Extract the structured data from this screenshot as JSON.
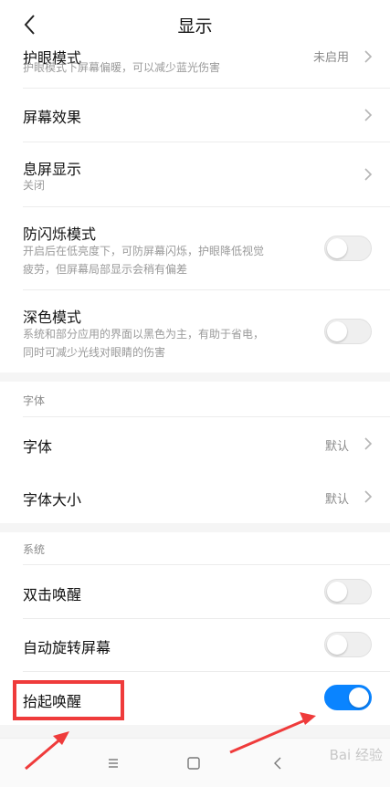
{
  "header": {
    "title": "显示"
  },
  "rows": {
    "eye_care": {
      "title": "护眼模式",
      "subtitle": "护眼模式下屏幕偏暖，可以减少蓝光伤害",
      "value": "未启用"
    },
    "screen_effect": {
      "title": "屏幕效果"
    },
    "ambient": {
      "title": "息屏显示",
      "subtitle": "关闭"
    },
    "flicker": {
      "title": "防闪烁模式",
      "subtitle1": "开启后在低亮度下，可防屏幕闪烁，护眼降低视觉",
      "subtitle2": "疲劳，但屏幕局部显示会稍有偏差",
      "on": false
    },
    "dark": {
      "title": "深色模式",
      "subtitle1": "系统和部分应用的界面以黑色为主，有助于省电，",
      "subtitle2": "同时可减少光线对眼睛的伤害",
      "on": false
    },
    "font": {
      "title": "字体",
      "value": "默认"
    },
    "font_size": {
      "title": "字体大小",
      "value": "默认"
    },
    "double_tap": {
      "title": "双击唤醒",
      "on": false
    },
    "auto_rotate": {
      "title": "自动旋转屏幕",
      "on": false
    },
    "lift_wake": {
      "title": "抬起唤醒",
      "on": true
    }
  },
  "sections": {
    "font": "字体",
    "system": "系统"
  },
  "watermark": "Bai 经验",
  "colors": {
    "accent": "#0a84ff",
    "annotation": "#ef3b3b"
  },
  "icons": {
    "back": "chevron-left-icon",
    "chevron": "chevron-right-icon",
    "menu": "menu-icon",
    "home": "square-home-icon",
    "nav_back": "triangle-back-icon"
  }
}
